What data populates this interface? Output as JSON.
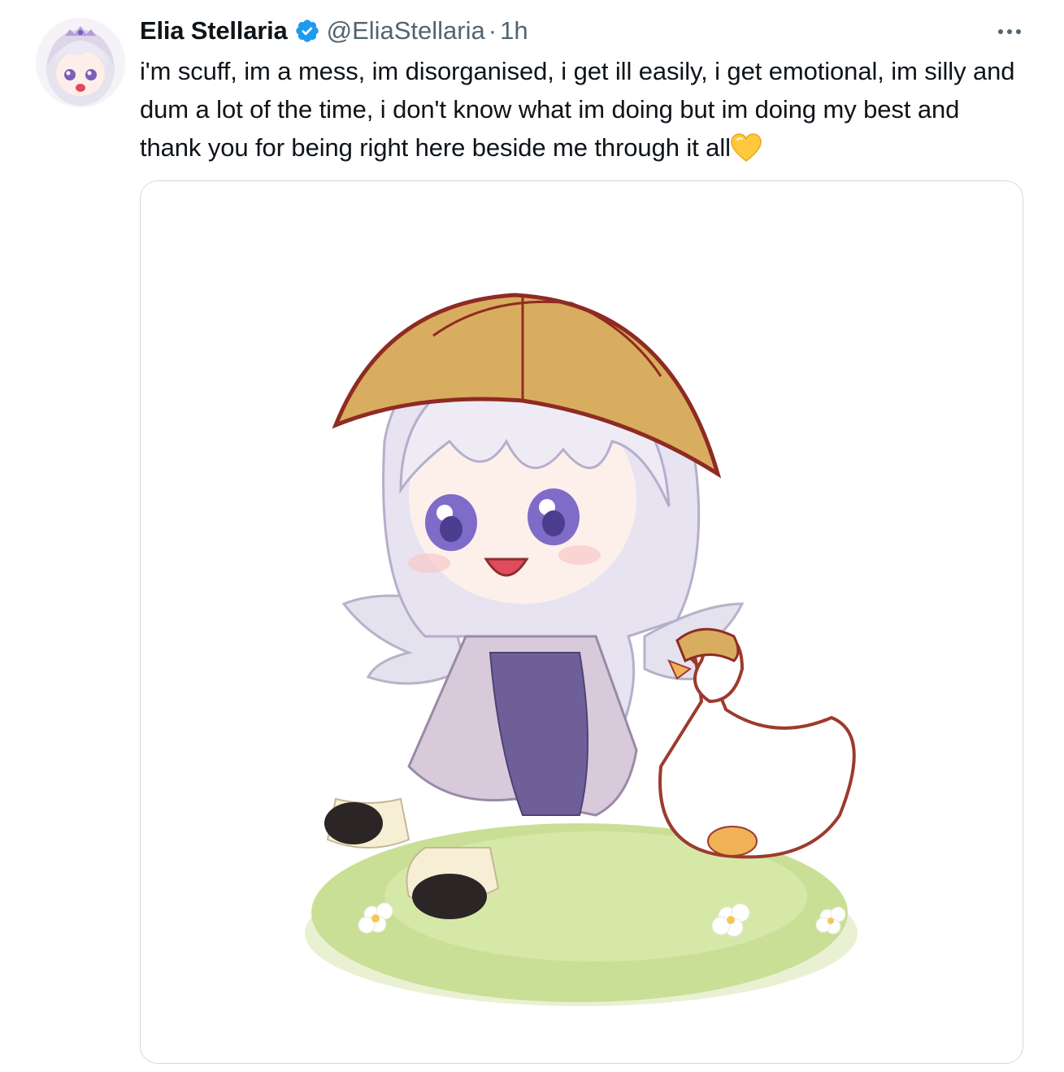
{
  "tweet": {
    "author": {
      "display_name": "Elia Stellaria",
      "handle": "@EliaStellaria",
      "verified": true,
      "avatar_icon": "avatar-chibi-girl"
    },
    "separator": "·",
    "time": "1h",
    "more_icon": "more-horizontal-icon",
    "text": "i'm scuff, im a mess, im disorganised, i get ill easily, i get emotional, im silly and dum a lot of the time, i don't know what im doing but im doing my best and thank you for being right here beside me through it all",
    "text_emoji": "yellow-heart",
    "media": {
      "type": "image",
      "subject": "chibi-girl-with-goose-illustration"
    }
  },
  "colors": {
    "text": "#0f1419",
    "secondary": "#536471",
    "verified": "#1d9bf0",
    "border": "#cfd9de",
    "heart": "#ffc83d"
  }
}
